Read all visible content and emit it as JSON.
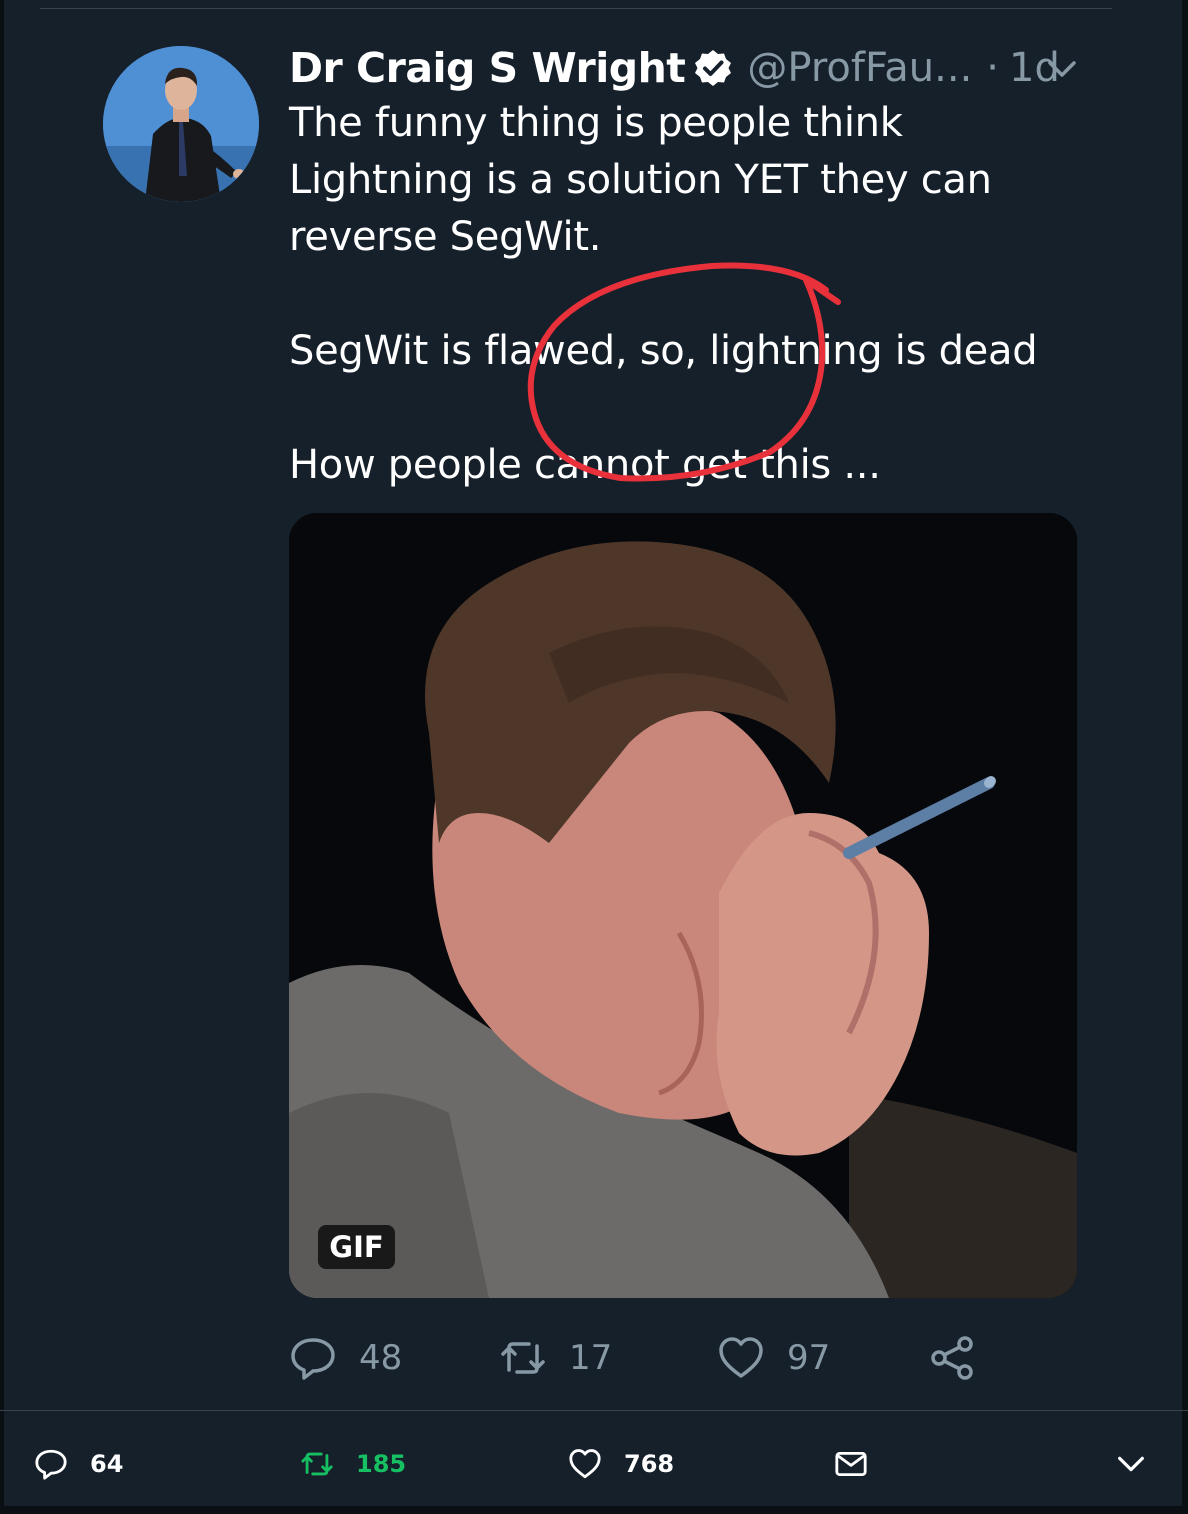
{
  "tweet": {
    "author_name": "Dr Craig S Wright",
    "handle": "@ProfFau...",
    "separator": "·",
    "time": "1d",
    "lines": [
      "The funny thing is people think",
      "Lightning is a solution YET they can",
      "reverse SegWit.",
      "SegWit is flawed, so, lightning is dead",
      "How people cannot get this ..."
    ],
    "media_badge": "GIF"
  },
  "actions": {
    "reply_count": "48",
    "retweet_count": "17",
    "like_count": "97"
  },
  "bottom_bar": {
    "reply_count": "64",
    "retweet_count": "185",
    "like_count": "768"
  },
  "icons": {
    "verified": "verified-badge-icon",
    "caret": "chevron-down-icon",
    "reply": "reply-icon",
    "retweet": "retweet-icon",
    "like": "heart-icon",
    "share": "share-icon",
    "mail": "mail-icon"
  },
  "colors": {
    "background": "#15202b",
    "muted_text": "#8899a6",
    "retweet_green": "#17bf63",
    "annotation_red": "#e8313a"
  }
}
